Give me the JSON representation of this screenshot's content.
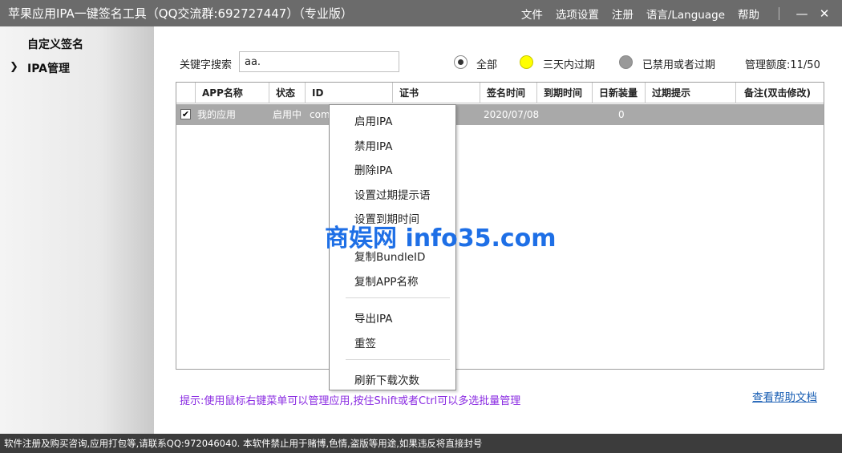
{
  "titlebar": {
    "title": "苹果应用IPA一键签名工具（QQ交流群:692727447）（专业版）",
    "menu": [
      "文件",
      "选项设置",
      "注册",
      "语言/Language",
      "帮助"
    ],
    "minimize": "—",
    "close": "✕"
  },
  "sidebar": {
    "items": [
      "自定义签名",
      "IPA管理"
    ],
    "arrow": "❯"
  },
  "search": {
    "label": "关键字搜索",
    "value": "aa."
  },
  "filters": {
    "all": "全部",
    "expiring": "三天内过期",
    "disabled": "已禁用或者过期",
    "quota": "管理额度:11/50",
    "colors": {
      "expiring": "#ffff00",
      "disabled": "#999999"
    }
  },
  "table": {
    "columns": [
      "APP名称",
      "状态",
      "ID",
      "证书",
      "签名时间",
      "到期时间",
      "日新装量",
      "过期提示",
      "备注(双击修改)"
    ],
    "rows": [
      {
        "checked": "✔",
        "app": "我的应用",
        "status": "启用中",
        "id": "com.",
        "cert": "",
        "sign_time": "2020/07/08",
        "expire": "",
        "daily": "0",
        "tip": "",
        "note": ""
      }
    ]
  },
  "context_menu": {
    "items": [
      "启用IPA",
      "禁用IPA",
      "删除IPA",
      "设置过期提示语",
      "设置到期时间",
      "复制BundleID",
      "复制APP名称",
      "导出IPA",
      "重签",
      "刷新下载次数"
    ]
  },
  "hint": "提示:使用鼠标右键菜单可以管理应用,按住Shift或者Ctrl可以多选批量管理",
  "help_link": "查看帮助文档",
  "watermark": "商娱网 info35.com",
  "statusbar": "软件注册及购买咨询,应用打包等,请联系QQ:972046040.  本软件禁止用于赌博,色情,盗版等用途,如果违反将直接封号"
}
